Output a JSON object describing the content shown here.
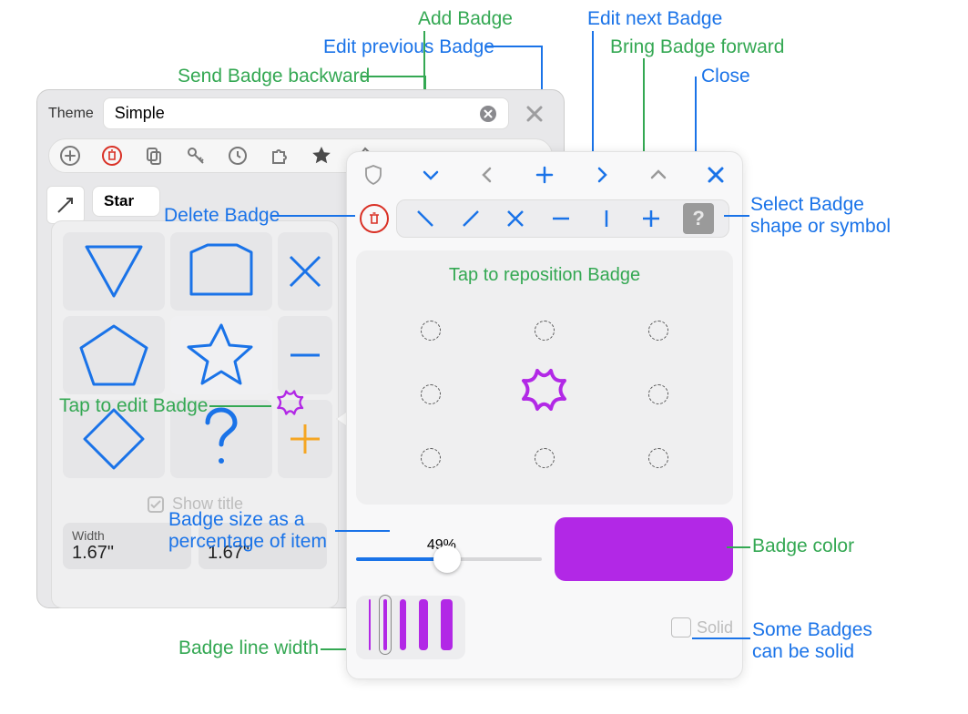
{
  "annotations": {
    "add_badge": "Add Badge",
    "edit_prev": "Edit previous Badge",
    "edit_next": "Edit next Badge",
    "send_backward": "Send Badge backward",
    "bring_forward": "Bring Badge forward",
    "close": "Close",
    "delete_badge": "Delete Badge",
    "select_shape_l1": "Select Badge",
    "select_shape_l2": "shape or symbol",
    "tap_reposition": "Tap to reposition Badge",
    "tap_edit": "Tap to edit Badge",
    "size_pct_l1": "Badge size as a",
    "size_pct_l2": "percentage of item",
    "badge_color": "Badge color",
    "line_width": "Badge line width",
    "solid_l1": "Some Badges",
    "solid_l2": "can be solid"
  },
  "back_panel": {
    "theme_label": "Theme",
    "theme_value": "Simple",
    "tab_label": "Star"
  },
  "shapes": {
    "show_title": "Show title",
    "width_label": "Width",
    "width_value": "1.67\"",
    "height_value": "1.67\""
  },
  "popover": {
    "slider_pct": "49%",
    "solid_label": "Solid",
    "line_widths": [
      2,
      4,
      6,
      9,
      12
    ]
  },
  "colors": {
    "blue": "#1a73e8",
    "green": "#34a853",
    "purple": "#b228e6",
    "orange": "#f5a623",
    "red": "#d93025"
  }
}
